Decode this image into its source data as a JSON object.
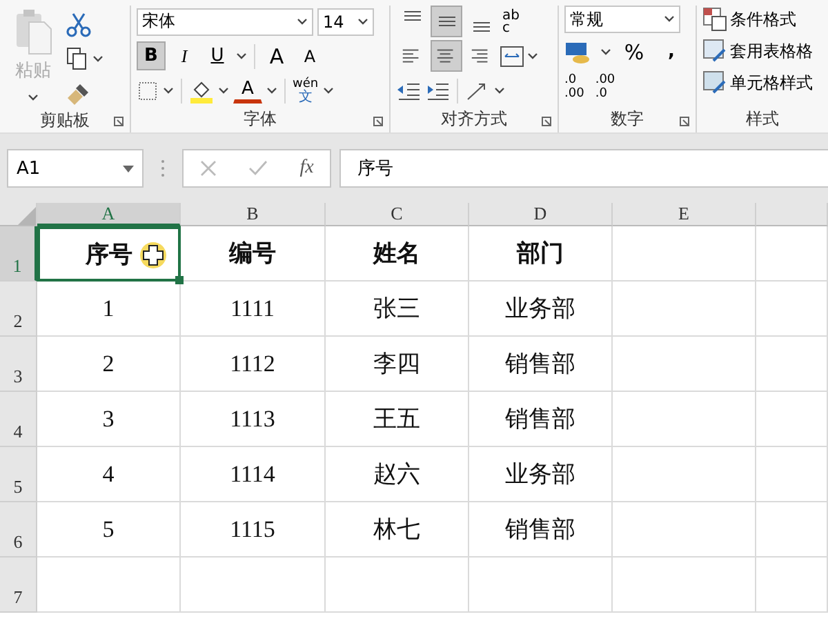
{
  "ribbon": {
    "clipboard": {
      "paste": "粘贴",
      "label": "剪贴板"
    },
    "font": {
      "font_name": "宋体",
      "font_size": "14",
      "label": "字体",
      "buttons": [
        {
          "kind": "bold",
          "text": "B",
          "selected": true
        },
        {
          "kind": "italic",
          "text": "I",
          "selected": false
        },
        {
          "kind": "underline",
          "text": "U",
          "selected": false
        }
      ],
      "grow": "A",
      "shrink": "A",
      "font_color": "A",
      "phonetic_top": "wén",
      "phonetic_bottom": "文"
    },
    "alignment": {
      "label": "对齐方式",
      "wrap_top": "ab",
      "wrap_bottom": "c",
      "vertical": [
        {
          "kind": "top",
          "selected": false
        },
        {
          "kind": "middle",
          "selected": true
        },
        {
          "kind": "bottom",
          "selected": false
        }
      ],
      "horizontal": [
        {
          "kind": "left",
          "selected": false
        },
        {
          "kind": "center",
          "selected": true
        },
        {
          "kind": "right",
          "selected": false
        }
      ]
    },
    "number": {
      "format": "常规",
      "percent": "%",
      "comma": ",",
      "increase_top": ".0",
      "increase_bottom": ".00",
      "decrease_top": ".00",
      "decrease_bottom": ".0",
      "label": "数字"
    },
    "styles": {
      "items": [
        "条件格式",
        "套用表格格",
        "单元格样式"
      ],
      "label": "样式"
    }
  },
  "formula_bar": {
    "name_box": "A1",
    "fx": "fx",
    "content": "序号"
  },
  "grid": {
    "columns": [
      {
        "label": "A",
        "selected": true
      },
      {
        "label": "B",
        "selected": false
      },
      {
        "label": "C",
        "selected": false
      },
      {
        "label": "D",
        "selected": false
      },
      {
        "label": "E",
        "selected": false
      }
    ],
    "rows": [
      {
        "number": "1",
        "selected": true,
        "header": true,
        "cells": [
          "序号",
          "编号",
          "姓名",
          "部门"
        ]
      },
      {
        "number": "2",
        "selected": false,
        "header": false,
        "cells": [
          "1",
          "1111",
          "张三",
          "业务部"
        ]
      },
      {
        "number": "3",
        "selected": false,
        "header": false,
        "cells": [
          "2",
          "1112",
          "李四",
          "销售部"
        ]
      },
      {
        "number": "4",
        "selected": false,
        "header": false,
        "cells": [
          "3",
          "1113",
          "王五",
          "销售部"
        ]
      },
      {
        "number": "5",
        "selected": false,
        "header": false,
        "cells": [
          "4",
          "1114",
          "赵六",
          "业务部"
        ]
      },
      {
        "number": "6",
        "selected": false,
        "header": false,
        "cells": [
          "5",
          "1115",
          "林七",
          "销售部"
        ]
      },
      {
        "number": "7",
        "selected": false,
        "header": false,
        "cells": []
      }
    ]
  }
}
